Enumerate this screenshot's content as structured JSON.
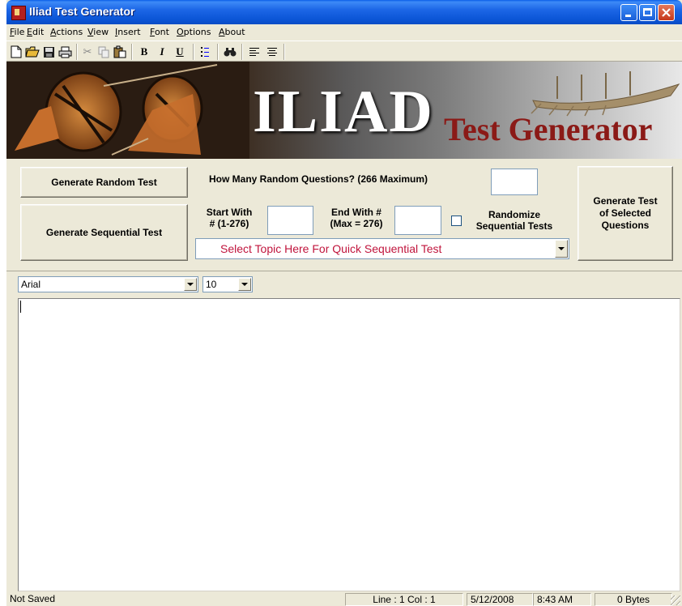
{
  "window": {
    "title": "Iliad Test Generator"
  },
  "menu": [
    "File",
    "Edit",
    "Actions",
    "View",
    "Insert",
    "Font",
    "Options",
    "About"
  ],
  "menu_underline": [
    "F",
    "E",
    "A",
    "V",
    "I",
    "F",
    "O",
    "A"
  ],
  "toolbar": {
    "bold_label": "B",
    "italic_label": "I",
    "underline_label": "U",
    "icons": [
      "new-document-icon",
      "open-folder-icon",
      "save-icon",
      "print-icon",
      "cut-icon",
      "copy-icon",
      "paste-icon",
      "bold-icon",
      "italic-icon",
      "underline-icon",
      "bullets-icon",
      "find-icon",
      "align-left-icon",
      "center-icon"
    ]
  },
  "banner": {
    "title": "ILIAD",
    "subtitle": "Test Generator"
  },
  "controls": {
    "generate_random_label": "Generate Random Test",
    "how_many_label": "How Many Random Questions? (266 Maximum)",
    "how_many_value": "",
    "generate_sequential_label": "Generate Sequential Test",
    "start_with_label_1": "Start With",
    "start_with_label_2": "# (1-276)",
    "start_value": "",
    "end_with_label_1": "End With #",
    "end_with_label_2": "(Max = 276)",
    "end_value": "",
    "randomize_label_1": "Randomize",
    "randomize_label_2": "Sequential Tests",
    "randomize_checked": false,
    "topic_select_value": "Select Topic Here For Quick Sequential Test",
    "generate_selected_label_1": "Generate Test",
    "generate_selected_label_2": "of Selected",
    "generate_selected_label_3": "Questions"
  },
  "font": {
    "family": "Arial",
    "size": "10"
  },
  "editor": {
    "content": ""
  },
  "status": {
    "saved": "Not Saved",
    "line_col": "Line : 1   Col : 1",
    "date": "5/12/2008",
    "time": "8:43 AM",
    "bytes": "0 Bytes"
  },
  "colors": {
    "accent_topic": "#c0143c",
    "banner_sub": "#8b1a17",
    "titlebar": "#0a5fe8"
  }
}
